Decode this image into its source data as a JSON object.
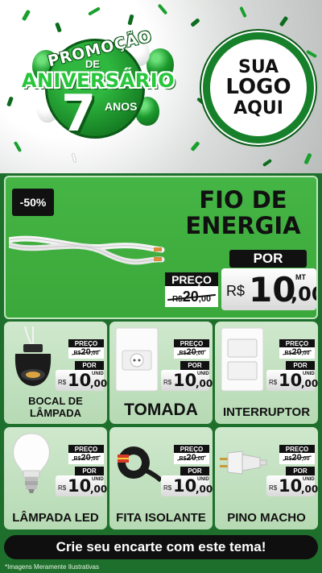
{
  "header": {
    "promo": {
      "line1": "PROMOÇÃO",
      "line2": "DE",
      "line3": "ANIVERSÁRIO",
      "number": "7",
      "years": "ANOS"
    },
    "logo": {
      "line1": "SUA",
      "line2": "LOGO",
      "line3": "AQUI"
    }
  },
  "featured": {
    "discount": "-50%",
    "title_line1": "FIO DE",
    "title_line2": "ENERGIA",
    "old_label": "PREÇO",
    "old_currency": "R$",
    "old_int": "20",
    "old_dec": ",00",
    "new_label": "POR",
    "new_currency": "R$",
    "new_int": "10",
    "new_dec": ",00",
    "unit": "MT"
  },
  "products": [
    {
      "name_line1": "BOCAL DE",
      "name_line2": "LÂMPADA",
      "old_label": "PREÇO",
      "old_currency": "R$",
      "old_int": "20",
      "old_dec": ",00",
      "new_label": "POR",
      "new_currency": "R$",
      "new_int": "10",
      "new_dec": ",00",
      "unit": "UNID"
    },
    {
      "name_line1": "TOMADA",
      "name_line2": "",
      "old_label": "PREÇO",
      "old_currency": "R$",
      "old_int": "20",
      "old_dec": ",00",
      "new_label": "POR",
      "new_currency": "R$",
      "new_int": "10",
      "new_dec": ",00",
      "unit": "UNID"
    },
    {
      "name_line1": "INTERRUPTOR",
      "name_line2": "",
      "old_label": "PREÇO",
      "old_currency": "R$",
      "old_int": "20",
      "old_dec": ",00",
      "new_label": "POR",
      "new_currency": "R$",
      "new_int": "10",
      "new_dec": ",00",
      "unit": "UNID"
    },
    {
      "name_line1": "LÂMPADA LED",
      "name_line2": "",
      "old_label": "PREÇO",
      "old_currency": "R$",
      "old_int": "20",
      "old_dec": ",00",
      "new_label": "POR",
      "new_currency": "R$",
      "new_int": "10",
      "new_dec": ",00",
      "unit": "UNID"
    },
    {
      "name_line1": "FITA ISOLANTE",
      "name_line2": "",
      "old_label": "PREÇO",
      "old_currency": "R$",
      "old_int": "20",
      "old_dec": ",00",
      "new_label": "POR",
      "new_currency": "R$",
      "new_int": "10",
      "new_dec": ",00",
      "unit": "UNID"
    },
    {
      "name_line1": "PINO MACHO",
      "name_line2": "",
      "old_label": "PREÇO",
      "old_currency": "R$",
      "old_int": "20",
      "old_dec": ",00",
      "new_label": "POR",
      "new_currency": "R$",
      "new_int": "10",
      "new_dec": ",00",
      "unit": "UNID"
    }
  ],
  "cta": "Crie seu encarte com este tema!",
  "footnote": "*Imagens Meramente Ilustrativas",
  "colors": {
    "primary_green": "#1f6f2c",
    "featured_green": "#3aa83a",
    "card_bg": "#c6e2c4",
    "price_black": "#111111"
  }
}
